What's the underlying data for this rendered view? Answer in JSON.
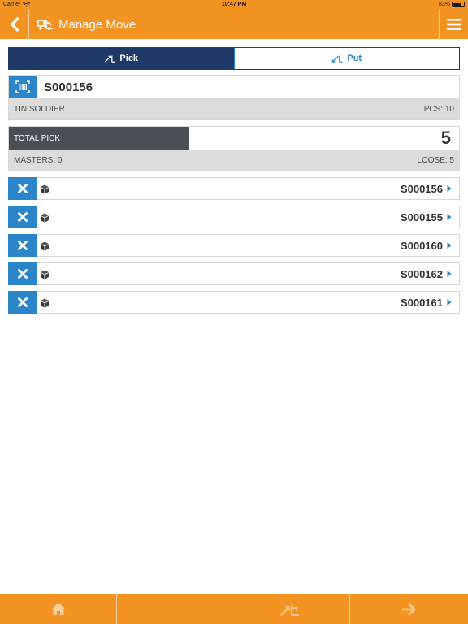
{
  "status": {
    "carrier": "Carrier",
    "time": "10:47 PM",
    "battery": "83%"
  },
  "header": {
    "title": "Manage Move",
    "back_icon": "chevron-left-icon",
    "menu_icon": "hamburger-icon",
    "title_icon": "forklift-icon"
  },
  "tabs": [
    {
      "label": "Pick",
      "icon": "forklift-pick-icon",
      "active": true
    },
    {
      "label": "Put",
      "icon": "forklift-put-icon",
      "active": false
    }
  ],
  "scan": {
    "code": "S000156",
    "description": "TIN SOLDIER",
    "pcs": "PCS: 10",
    "icon": "barcode-icon"
  },
  "pick": {
    "label": "TOTAL PICK",
    "count": "5",
    "progress": 0.4,
    "masters": "MASTERS: 0",
    "loose": "LOOSE: 5"
  },
  "items": [
    {
      "code": "S000156"
    },
    {
      "code": "S000155"
    },
    {
      "code": "S000160"
    },
    {
      "code": "S000162"
    },
    {
      "code": "S000161"
    }
  ],
  "footer": {
    "icons": [
      "home-icon",
      "forklift-icon",
      "arrow-right-icon"
    ]
  },
  "colors": {
    "accent": "#f39422",
    "navy": "#1f3a68",
    "blue": "#2a86c8",
    "dark_bar": "#4a4f55"
  }
}
